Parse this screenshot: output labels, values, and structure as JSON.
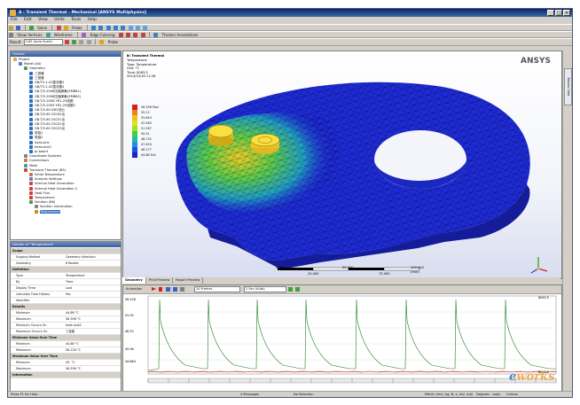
{
  "window": {
    "title": "A : Transient Thermal - Mechanical [ANSYS Multiphysics]",
    "minimize": "_",
    "maximize": "□",
    "close": "✕"
  },
  "menu": [
    "File",
    "Edit",
    "View",
    "Units",
    "Tools",
    "Help"
  ],
  "toolbar1": {
    "solve": "Solve",
    "probe_label": "Probe"
  },
  "toolbar2": {
    "show_vertices": "Show Vertices",
    "wireframe": "Wireframe",
    "edge_coloring": "Edge Coloring",
    "thicken_annotations": "Thicken Annotations"
  },
  "toolbar3": {
    "result_label": "Result",
    "result_value": "0.85 (Auto Scale)",
    "probe": "Probe"
  },
  "outline": {
    "header": "Outline",
    "items": [
      {
        "label": "Project",
        "depth": 0,
        "icon": "#d8b040"
      },
      {
        "label": "Model (A4)",
        "depth": 1,
        "icon": "#4a80c8"
      },
      {
        "label": "Geometry",
        "depth": 2,
        "icon": "#40a060"
      },
      {
        "label": "三极管",
        "depth": 3,
        "icon": "#2a70c0"
      },
      {
        "label": "三极管",
        "depth": 3,
        "icon": "#2a70c0"
      },
      {
        "label": "GB/T5-1-41整流管1",
        "depth": 3,
        "icon": "#2a70c0"
      },
      {
        "label": "GB/T5-1-42整流管2",
        "depth": 3,
        "icon": "#2a70c0"
      },
      {
        "label": "GB-T/5-2008压缩弹簧(ZMB61)",
        "depth": 3,
        "icon": "#2a70c0"
      },
      {
        "label": "GB-T/5-2008压缩弹簧(ZMB62)",
        "depth": 3,
        "icon": "#2a70c0"
      },
      {
        "label": "GB-T/5-2008 YR1-25线圈",
        "depth": 3,
        "icon": "#2a70c0"
      },
      {
        "label": "GB-T/5-2009 YR1-25线圈2",
        "depth": 3,
        "icon": "#2a70c0"
      },
      {
        "label": "GB-T/5-80 DR2进出",
        "depth": 3,
        "icon": "#2a70c0"
      },
      {
        "label": "GB-T/5-80 2SC00出",
        "depth": 3,
        "icon": "#2a70c0"
      },
      {
        "label": "GB-T/5-80 2SC01出",
        "depth": 3,
        "icon": "#2a70c0"
      },
      {
        "label": "GB-T/5-80 2SC02出",
        "depth": 3,
        "icon": "#2a70c0"
      },
      {
        "label": "GB-T/5-80 2SC03出",
        "depth": 3,
        "icon": "#2a70c0"
      },
      {
        "label": "电阻1",
        "depth": 3,
        "icon": "#2a70c0"
      },
      {
        "label": "电阻2",
        "depth": 3,
        "icon": "#2a70c0"
      },
      {
        "label": "heat-sink",
        "depth": 3,
        "icon": "#2a70c0"
      },
      {
        "label": "heat-sink2",
        "depth": 3,
        "icon": "#2a70c0"
      },
      {
        "label": "pi-board",
        "depth": 3,
        "icon": "#2a70c0"
      },
      {
        "label": "Coordinate Systems",
        "depth": 2,
        "icon": "#808080"
      },
      {
        "label": "Connections",
        "depth": 2,
        "icon": "#c08040"
      },
      {
        "label": "Mesh",
        "depth": 2,
        "icon": "#40a0a0"
      },
      {
        "label": "Transient Thermal (B5)",
        "depth": 2,
        "icon": "#d04040"
      },
      {
        "label": "Initial Temperature",
        "depth": 3,
        "icon": "#d07040"
      },
      {
        "label": "Analysis Settings",
        "depth": 3,
        "icon": "#6080c0"
      },
      {
        "label": "Internal Heat Generation",
        "depth": 3,
        "icon": "#d04040"
      },
      {
        "label": "Internal Heat Generation 2",
        "depth": 3,
        "icon": "#d04040"
      },
      {
        "label": "Heat Flux",
        "depth": 3,
        "icon": "#d04040"
      },
      {
        "label": "Temperature",
        "depth": 3,
        "icon": "#d04040"
      },
      {
        "label": "Solution (B6)",
        "depth": 3,
        "icon": "#40a040"
      },
      {
        "label": "Solution Information",
        "depth": 4,
        "icon": "#808080"
      },
      {
        "label": "Temperature",
        "depth": 4,
        "icon": "#d08030"
      }
    ]
  },
  "details": {
    "header": "Details of \"Temperature\"",
    "rows": [
      {
        "k": "Scope",
        "v": "",
        "cat": true
      },
      {
        "k": "Scoping Method",
        "v": "Geometry Selection",
        "cat": false
      },
      {
        "k": "Geometry",
        "v": "6 Bodies",
        "cat": false
      },
      {
        "k": "Definition",
        "v": "",
        "cat": true
      },
      {
        "k": "Type",
        "v": "Temperature",
        "cat": false
      },
      {
        "k": "By",
        "v": "Time",
        "cat": false
      },
      {
        "k": "Display Time",
        "v": "Last",
        "cat": false
      },
      {
        "k": "Calculate Time History",
        "v": "Yes",
        "cat": false
      },
      {
        "k": "Identifier",
        "v": "",
        "cat": false
      },
      {
        "k": "Results",
        "v": "",
        "cat": true
      },
      {
        "k": "Minimum",
        "v": "44.88 °C",
        "cat": false
      },
      {
        "k": "Maximum",
        "v": "56.396 °C",
        "cat": false
      },
      {
        "k": "Minimum Occurs On",
        "v": "heat-sink2",
        "cat": false
      },
      {
        "k": "Maximum Occurs On",
        "v": "三极管",
        "cat": false
      },
      {
        "k": "Minimum Value Over Time",
        "v": "",
        "cat": true
      },
      {
        "k": "Minimum",
        "v": "44.88 °C",
        "cat": false
      },
      {
        "k": "Maximum",
        "v": "56.228 °C",
        "cat": false
      },
      {
        "k": "Maximum Value Over Time",
        "v": "",
        "cat": true
      },
      {
        "k": "Minimum",
        "v": "45. °C",
        "cat": false
      },
      {
        "k": "Maximum",
        "v": "56.396 °C",
        "cat": false
      },
      {
        "k": "Information",
        "v": "",
        "cat": true
      }
    ]
  },
  "graphics": {
    "title": "B: Transient Thermal",
    "info": [
      "Temperature",
      "Type: Temperature",
      "Unit: °C",
      "Time: 8063.5",
      "2014/10/16 11:28"
    ],
    "logo": "ANSYS",
    "legend": [
      {
        "label": "56.396 Max",
        "color": "#d42020"
      },
      {
        "label": "55.12",
        "color": "#f08020"
      },
      {
        "label": "53.843",
        "color": "#f0c020"
      },
      {
        "label": "52.565",
        "color": "#e0e020"
      },
      {
        "label": "51.287",
        "color": "#a0e020"
      },
      {
        "label": "50.01",
        "color": "#40d040"
      },
      {
        "label": "48.732",
        "color": "#20c0a0"
      },
      {
        "label": "47.454",
        "color": "#2090e0"
      },
      {
        "label": "46.177",
        "color": "#2050e0"
      },
      {
        "label": "44.88 Min",
        "color": "#1a24c8"
      }
    ],
    "scale": {
      "t0": "0.000",
      "t1": "50.000",
      "t2": "100.000 (mm)",
      "t3": "25.000",
      "t4": "75.000"
    }
  },
  "tabs": [
    "Geometry",
    "Print Preview",
    "Report Preview"
  ],
  "graph": {
    "label": "Animation",
    "frames": "10 Frames",
    "duration": "2 Sec (Auto)",
    "ymax": "56.228",
    "ylabels": [
      "56.228",
      "52.05",
      "48.53",
      "45.96",
      "44.884"
    ],
    "end_top": "8063.5",
    "end_bottom": "8063.5"
  },
  "sidetab": "Tabular Data",
  "status": {
    "help": "Press F1 for Help",
    "messages": "4 Messages",
    "selection": "No Selection",
    "units": "Metric (mm, kg, N, s, mV, mA)",
    "deg": "Degrees",
    "rads": "rad/s",
    "temp": "Celsius"
  },
  "watermark": {
    "e": "e",
    "rest": "works"
  }
}
